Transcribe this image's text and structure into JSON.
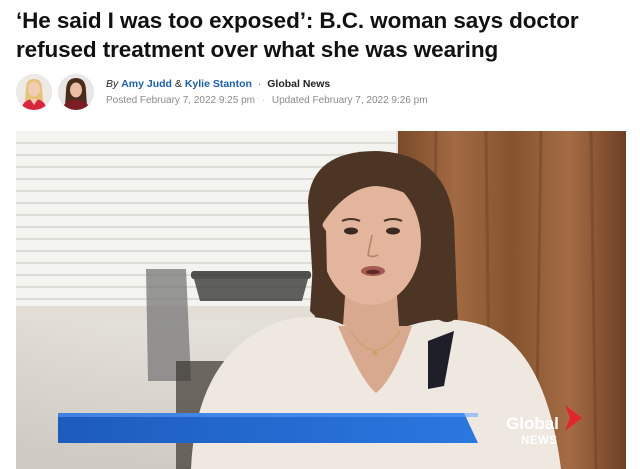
{
  "article": {
    "headline": "‘He said I was too exposed’: B.C. woman says doctor refused treatment over what she was wearing"
  },
  "byline": {
    "by_label": "By",
    "authors": [
      "Amy Judd",
      "Kylie Stanton"
    ],
    "joiner": "&",
    "outlet": "Global News",
    "posted": "Posted February 7, 2022 9:25 pm",
    "updated": "Updated February 7, 2022 9:26 pm"
  },
  "video": {
    "watermark_line1": "Global",
    "watermark_line2": "NEWS"
  },
  "colors": {
    "author_link": "#1a5fb4",
    "lower_third_blue": "#1e5fc0",
    "logo_red": "#e3262b"
  }
}
